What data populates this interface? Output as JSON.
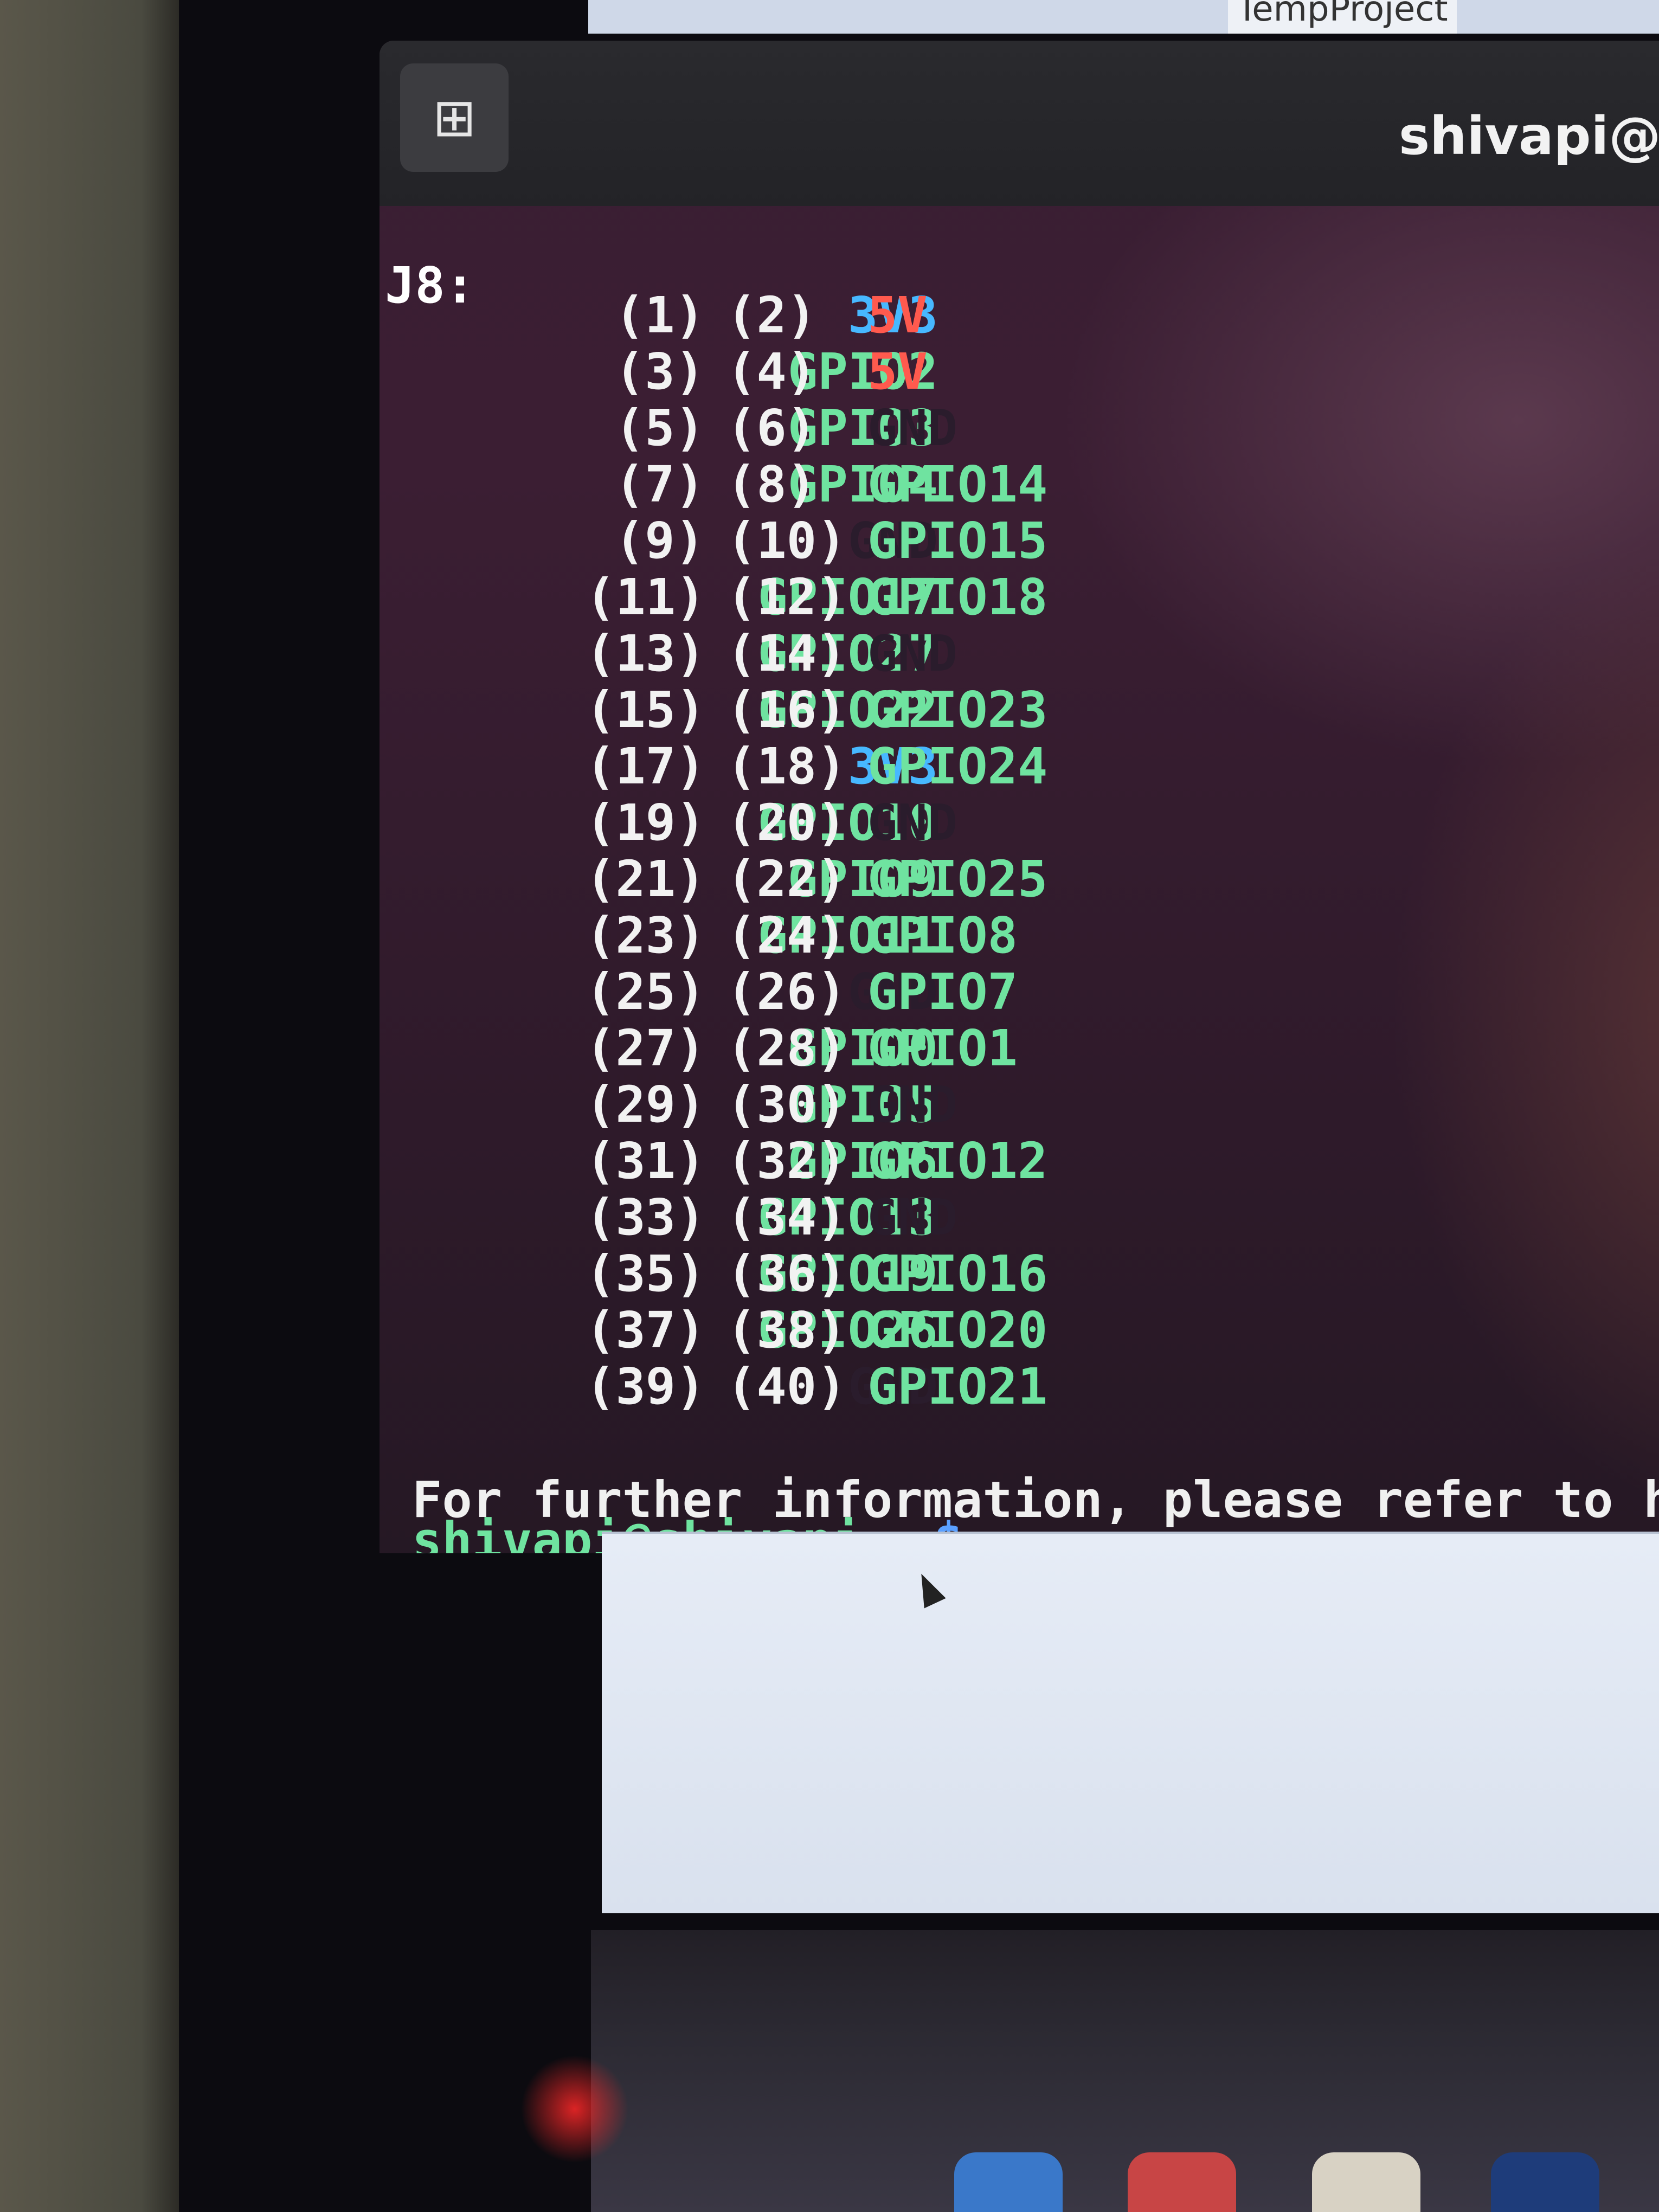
{
  "top_window": {
    "title": "TempProject"
  },
  "terminal": {
    "window_title": "shivapi@sh",
    "new_tab_icon": "new-tab-icon",
    "header": "J8:",
    "rows": [
      {
        "lname": "3V3",
        "lcolor": "3v3",
        "lnum": "(1)",
        "rnum": "(2)",
        "rname": "5V",
        "rcolor": "5v"
      },
      {
        "lname": "GPIO2",
        "lcolor": "gpio",
        "lnum": "(3)",
        "rnum": "(4)",
        "rname": "5V",
        "rcolor": "5v"
      },
      {
        "lname": "GPIO3",
        "lcolor": "gpio",
        "lnum": "(5)",
        "rnum": "(6)",
        "rname": "GND",
        "rcolor": "gnd"
      },
      {
        "lname": "GPIO4",
        "lcolor": "gpio",
        "lnum": "(7)",
        "rnum": "(8)",
        "rname": "GPIO14",
        "rcolor": "gpio"
      },
      {
        "lname": "GND",
        "lcolor": "gnd",
        "lnum": "(9)",
        "rnum": "(10)",
        "rname": "GPIO15",
        "rcolor": "gpio"
      },
      {
        "lname": "GPIO17",
        "lcolor": "gpio",
        "lnum": "(11)",
        "rnum": "(12)",
        "rname": "GPIO18",
        "rcolor": "gpio"
      },
      {
        "lname": "GPIO27",
        "lcolor": "gpio",
        "lnum": "(13)",
        "rnum": "(14)",
        "rname": "GND",
        "rcolor": "gnd"
      },
      {
        "lname": "GPIO22",
        "lcolor": "gpio",
        "lnum": "(15)",
        "rnum": "(16)",
        "rname": "GPIO23",
        "rcolor": "gpio"
      },
      {
        "lname": "3V3",
        "lcolor": "3v3",
        "lnum": "(17)",
        "rnum": "(18)",
        "rname": "GPIO24",
        "rcolor": "gpio"
      },
      {
        "lname": "GPIO10",
        "lcolor": "gpio",
        "lnum": "(19)",
        "rnum": "(20)",
        "rname": "GND",
        "rcolor": "gnd"
      },
      {
        "lname": "GPIO9",
        "lcolor": "gpio",
        "lnum": "(21)",
        "rnum": "(22)",
        "rname": "GPIO25",
        "rcolor": "gpio"
      },
      {
        "lname": "GPIO11",
        "lcolor": "gpio",
        "lnum": "(23)",
        "rnum": "(24)",
        "rname": "GPIO8",
        "rcolor": "gpio"
      },
      {
        "lname": "GND",
        "lcolor": "gnd",
        "lnum": "(25)",
        "rnum": "(26)",
        "rname": "GPIO7",
        "rcolor": "gpio"
      },
      {
        "lname": "GPIO0",
        "lcolor": "gpio",
        "lnum": "(27)",
        "rnum": "(28)",
        "rname": "GPIO1",
        "rcolor": "gpio"
      },
      {
        "lname": "GPIO5",
        "lcolor": "gpio",
        "lnum": "(29)",
        "rnum": "(30)",
        "rname": "GND",
        "rcolor": "gnd"
      },
      {
        "lname": "GPIO6",
        "lcolor": "gpio",
        "lnum": "(31)",
        "rnum": "(32)",
        "rname": "GPIO12",
        "rcolor": "gpio"
      },
      {
        "lname": "GPIO13",
        "lcolor": "gpio",
        "lnum": "(33)",
        "rnum": "(34)",
        "rname": "GND",
        "rcolor": "gnd"
      },
      {
        "lname": "GPIO19",
        "lcolor": "gpio",
        "lnum": "(35)",
        "rnum": "(36)",
        "rname": "GPIO16",
        "rcolor": "gpio"
      },
      {
        "lname": "GPIO26",
        "lcolor": "gpio",
        "lnum": "(37)",
        "rnum": "(38)",
        "rname": "GPIO20",
        "rcolor": "gpio"
      },
      {
        "lname": "GND",
        "lcolor": "gnd",
        "lnum": "(39)",
        "rnum": "(40)",
        "rname": "GPIO21",
        "rcolor": "gpio"
      }
    ],
    "info_line": "For further information, please refer to https:/",
    "prompt": {
      "user_host": "shivapi@shivapi:",
      "path": "~",
      "symbol": "$"
    }
  },
  "colors": {
    "gpio": "#6fe3a0",
    "v33": "#47b8ff",
    "v5": "#ff5a4e",
    "gnd": "#2a1c2c",
    "terminal_bg": "#3a1f33"
  }
}
